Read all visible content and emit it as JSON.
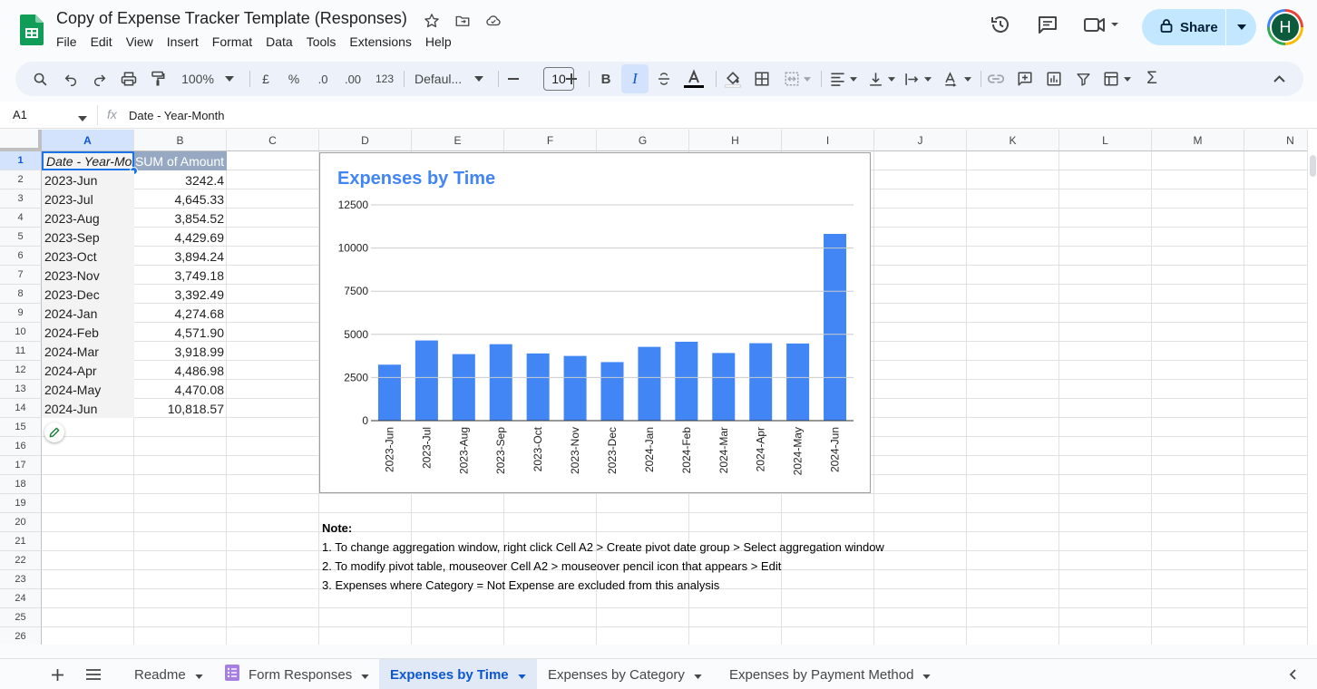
{
  "app": {
    "doc_title": "Copy of Expense Tracker Template (Responses)",
    "menu": [
      "File",
      "Edit",
      "View",
      "Insert",
      "Format",
      "Data",
      "Tools",
      "Extensions",
      "Help"
    ],
    "share_label": "Share",
    "avatar_letter": "H"
  },
  "toolbar": {
    "zoom": "100%",
    "currency": "£",
    "percent": "%",
    "dec_decrease": ".0",
    "dec_increase": ".00",
    "number_format": "123",
    "font_family": "Defaul...",
    "font_size": "10"
  },
  "formula_bar": {
    "name_box": "A1",
    "fx": "fx",
    "content": "Date - Year-Month"
  },
  "columns": [
    "A",
    "B",
    "C",
    "D",
    "E",
    "F",
    "G",
    "H",
    "I",
    "J",
    "K",
    "L",
    "M",
    "N"
  ],
  "rows": [
    "1",
    "2",
    "3",
    "4",
    "5",
    "6",
    "7",
    "8",
    "9",
    "10",
    "11",
    "12",
    "13",
    "14",
    "15",
    "16",
    "17",
    "18",
    "19",
    "20",
    "21",
    "22",
    "23",
    "24",
    "25",
    "26"
  ],
  "table": {
    "header_a": "Date - Year-Month",
    "header_b": "SUM of Amount",
    "data": [
      {
        "month": "2023-Jun",
        "amount": "3242.4"
      },
      {
        "month": "2023-Jul",
        "amount": "4,645.33"
      },
      {
        "month": "2023-Aug",
        "amount": "3,854.52"
      },
      {
        "month": "2023-Sep",
        "amount": "4,429.69"
      },
      {
        "month": "2023-Oct",
        "amount": "3,894.24"
      },
      {
        "month": "2023-Nov",
        "amount": "3,749.18"
      },
      {
        "month": "2023-Dec",
        "amount": "3,392.49"
      },
      {
        "month": "2024-Jan",
        "amount": "4,274.68"
      },
      {
        "month": "2024-Feb",
        "amount": "4,571.90"
      },
      {
        "month": "2024-Mar",
        "amount": "3,918.99"
      },
      {
        "month": "2024-Apr",
        "amount": "4,486.98"
      },
      {
        "month": "2024-May",
        "amount": "4,470.08"
      },
      {
        "month": "2024-Jun",
        "amount": "10,818.57"
      }
    ]
  },
  "chart_data": {
    "type": "bar",
    "title": "Expenses by Time",
    "categories": [
      "2023-Jun",
      "2023-Jul",
      "2023-Aug",
      "2023-Sep",
      "2023-Oct",
      "2023-Nov",
      "2023-Dec",
      "2024-Jan",
      "2024-Feb",
      "2024-Mar",
      "2024-Apr",
      "2024-May",
      "2024-Jun"
    ],
    "values": [
      3242.4,
      4645.33,
      3854.52,
      4429.69,
      3894.24,
      3749.18,
      3392.49,
      4274.68,
      4571.9,
      3918.99,
      4486.98,
      4470.08,
      10818.57
    ],
    "yticks": [
      "0",
      "2500",
      "5000",
      "7500",
      "10000",
      "12500"
    ],
    "ylim": [
      0,
      12500
    ],
    "grid": true,
    "bar_color": "#4285f4"
  },
  "notes": {
    "heading": "Note:",
    "lines": [
      "1. To change aggregation window, right click Cell A2 > Create pivot date group > Select aggregation window",
      "2. To modify pivot table, mouseover Cell A2 > mouseover pencil icon that appears > Edit",
      "3. Expenses where Category = Not Expense are excluded from this analysis"
    ]
  },
  "sheets": [
    {
      "name": "Readme",
      "active": false
    },
    {
      "name": "Form Responses",
      "active": false
    },
    {
      "name": "Expenses by Time",
      "active": true
    },
    {
      "name": "Expenses by Category",
      "active": false
    },
    {
      "name": "Expenses by Payment Method",
      "active": false
    }
  ],
  "colors": {
    "accent": "#0b57d0",
    "chart_title": "#4285f4",
    "pivot_header": "#97a9c2"
  }
}
